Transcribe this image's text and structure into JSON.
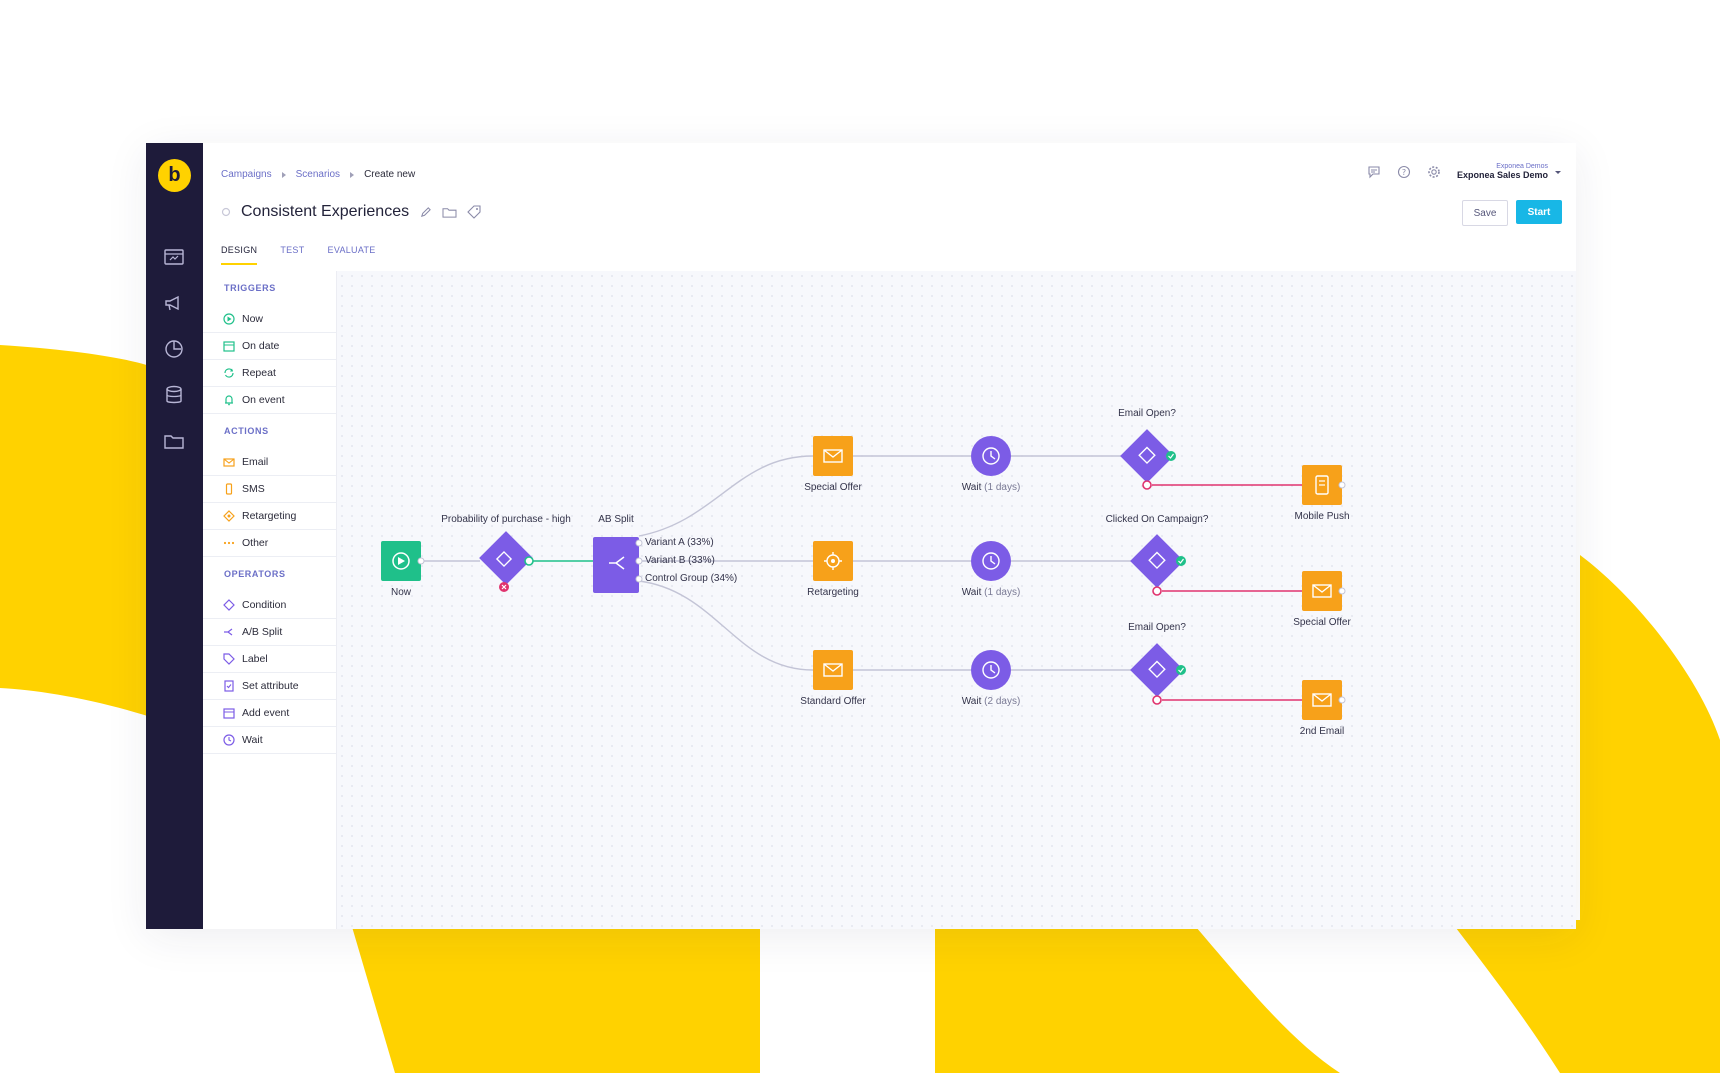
{
  "breadcrumb": {
    "campaigns": "Campaigns",
    "scenarios": "Scenarios",
    "current": "Create new"
  },
  "scenario": {
    "title": "Consistent Experiences"
  },
  "tabs": {
    "design": "DESIGN",
    "test": "TEST",
    "evaluate": "EVALUATE"
  },
  "account": {
    "org": "Exponea Demos",
    "name": "Exponea Sales Demo"
  },
  "buttons": {
    "save": "Save",
    "start": "Start"
  },
  "palette": {
    "triggers_title": "TRIGGERS",
    "triggers": [
      "Now",
      "On date",
      "Repeat",
      "On event"
    ],
    "actions_title": "ACTIONS",
    "actions": [
      "Email",
      "SMS",
      "Retargeting",
      "Other"
    ],
    "operators_title": "OPERATORS",
    "operators": [
      "Condition",
      "A/B Split",
      "Label",
      "Set attribute",
      "Add event",
      "Wait"
    ]
  },
  "flow": {
    "now": "Now",
    "condition": "Probability of purchase - high",
    "ab_split": "AB Split",
    "variant_a": "Variant A (33%)",
    "variant_b": "Variant B (33%)",
    "control": "Control Group (34%)",
    "special_offer": "Special Offer",
    "retargeting": "Retargeting",
    "standard_offer": "Standard Offer",
    "wait_label": "Wait",
    "wait_1": "(1 days)",
    "wait_2": "(1 days)",
    "wait_3": "(2 days)",
    "email_open_1": "Email Open?",
    "clicked": "Clicked On Campaign?",
    "email_open_2": "Email Open?",
    "mobile_push": "Mobile Push",
    "special_offer_2": "Special Offer",
    "second_email": "2nd Email"
  },
  "colors": {
    "brand_yellow": "#ffd200",
    "rail": "#1e1b3a",
    "accent_blue": "#18b7e6",
    "purple": "#7c5ce6",
    "orange": "#f7a11a",
    "green": "#1fc08a",
    "pink": "#e0336e"
  }
}
